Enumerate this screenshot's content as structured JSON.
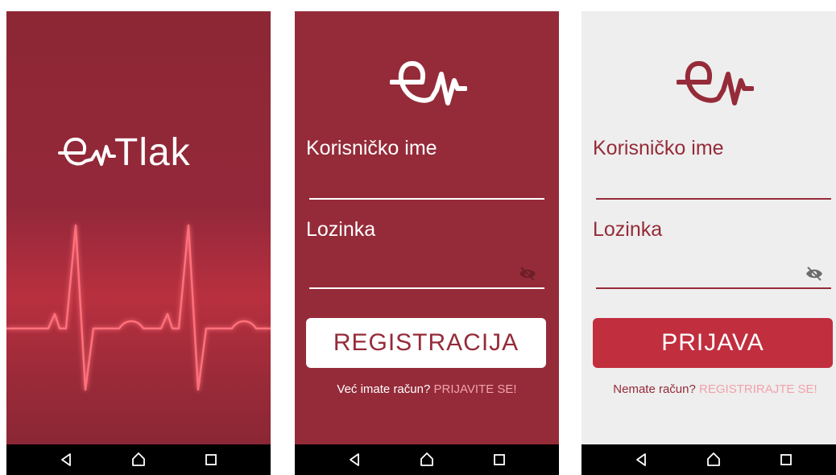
{
  "colors": {
    "brand": "#952b39",
    "brand_bright": "#c12e3e",
    "ecg_line": "#ff6f7a",
    "link": "#f2a1ab",
    "light_bg": "#eeeeee",
    "navbar": "#000000"
  },
  "splash": {
    "logo_text": "Tlak",
    "logo_icon": "heart-ecg-logo-icon",
    "illustration": "heartbeat-ecg-line"
  },
  "register": {
    "logo_icon": "heart-ecg-logo-icon",
    "username_label": "Korisničko ime",
    "password_label": "Lozinka",
    "password_toggle_icon": "eye-off-icon",
    "submit_label": "REGISTRACIJA",
    "prompt_text": "Već imate račun?",
    "prompt_link": "PRIJAVITE SE!"
  },
  "login": {
    "logo_icon": "heart-ecg-logo-icon",
    "username_label": "Korisničko ime",
    "password_label": "Lozinka",
    "password_toggle_icon": "eye-off-icon",
    "submit_label": "PRIJAVA",
    "prompt_text": "Nemate račun?",
    "prompt_link": "REGISTRIRAJTE SE!"
  },
  "navbar": {
    "icons": [
      "back-icon",
      "home-icon",
      "recent-apps-icon"
    ]
  }
}
